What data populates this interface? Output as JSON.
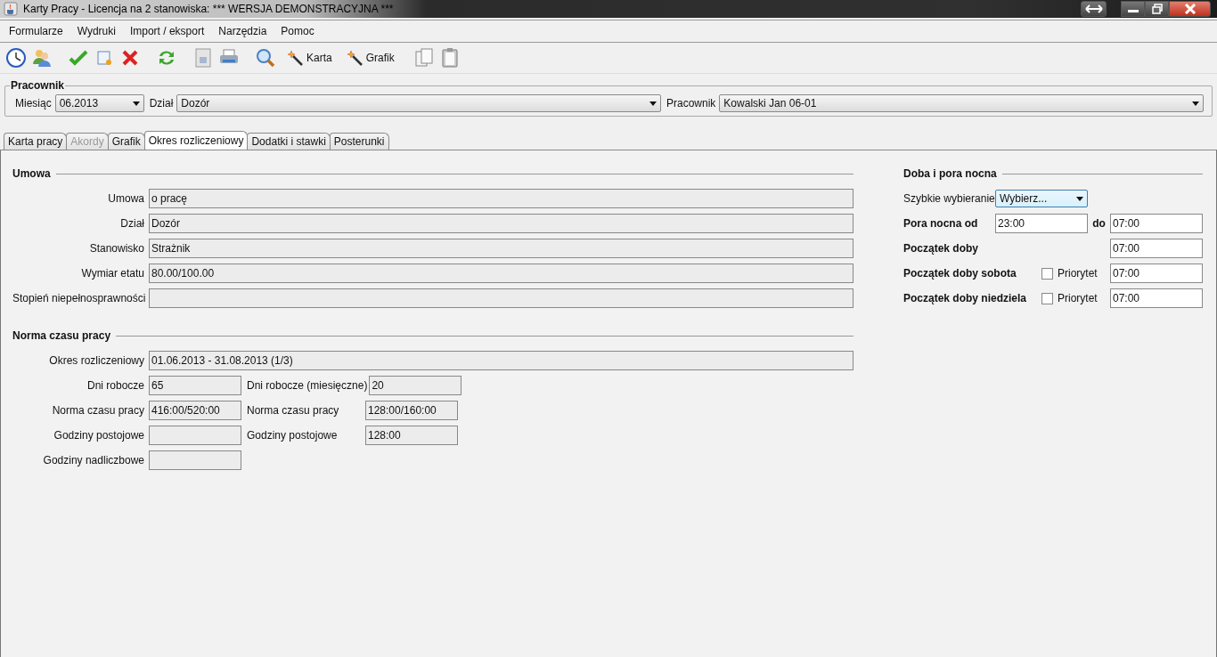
{
  "window": {
    "title": "Karty Pracy  -  Licencja na 2 stanowiska: *** WERSJA DEMONSTRACYJNA ***"
  },
  "menu": [
    "Formularze",
    "Wydruki",
    "Import / eksport",
    "Narzędzia",
    "Pomoc"
  ],
  "toolbar_buttons": [
    {
      "label": "Karta"
    },
    {
      "label": "Grafik"
    }
  ],
  "pracownik": {
    "title": "Pracownik",
    "fields": [
      {
        "label": "Miesiąc",
        "value": "06.2013",
        "kind": "month"
      },
      {
        "label": "Dział",
        "value": "Dozór",
        "kind": "wide"
      },
      {
        "label": "Pracownik",
        "value": "Kowalski Jan 06-01",
        "kind": "wide"
      }
    ]
  },
  "tabs": [
    {
      "label": "Karta pracy",
      "selected": false,
      "disabled": false
    },
    {
      "label": "Akordy",
      "selected": false,
      "disabled": true
    },
    {
      "label": "Grafik",
      "selected": false,
      "disabled": false
    },
    {
      "label": "Okres rozliczeniowy",
      "selected": true,
      "disabled": false
    },
    {
      "label": "Dodatki i stawki",
      "selected": false,
      "disabled": false
    },
    {
      "label": "Posterunki",
      "selected": false,
      "disabled": false
    }
  ],
  "umowa": {
    "title": "Umowa",
    "rows": [
      {
        "label": "Umowa",
        "value": "o pracę"
      },
      {
        "label": "Dział",
        "value": "Dozór"
      },
      {
        "label": "Stanowisko",
        "value": "Strażnik"
      },
      {
        "label": "Wymiar etatu",
        "value": "80.00/100.00"
      },
      {
        "label": "Stopień niepełnosprawności"
      }
    ]
  },
  "norma": {
    "title": "Norma czasu pracy",
    "period": {
      "label": "Okres rozliczeniowy",
      "value": "01.06.2013 - 31.08.2013 (1/3)"
    },
    "rows": [
      {
        "cells": [
          {
            "label": "Dni robocze",
            "value": "65"
          },
          {
            "label": "Dni robocze (miesięczne)",
            "value": "20"
          }
        ]
      },
      {
        "cells": [
          {
            "label": "Norma czasu pracy",
            "value": "416:00/520:00"
          },
          {
            "label": "Norma czasu pracy",
            "value": "128:00/160:00"
          }
        ]
      },
      {
        "cells": [
          {
            "label": "Godziny postojowe"
          },
          {
            "label": "Godziny postojowe",
            "value": "128:00"
          }
        ]
      },
      {
        "cells": [
          {
            "label": "Godziny nadliczbowe"
          }
        ]
      }
    ]
  },
  "doba": {
    "title": "Doba i pora nocna",
    "quick": {
      "label": "Szybkie wybieranie",
      "value": "Wybierz..."
    },
    "rows": [
      {
        "kind": "range",
        "label": "Pora nocna od",
        "from": "23:00",
        "to_label": "do",
        "to": "07:00"
      },
      {
        "kind": "plain",
        "label": "Początek doby",
        "value": "07:00"
      },
      {
        "kind": "priority",
        "label": "Początek doby sobota",
        "check_label": "Priorytet",
        "checked": false,
        "value": "07:00"
      },
      {
        "kind": "priority",
        "label": "Początek doby niedziela",
        "check_label": "Priorytet",
        "checked": false,
        "value": "07:00"
      }
    ]
  }
}
